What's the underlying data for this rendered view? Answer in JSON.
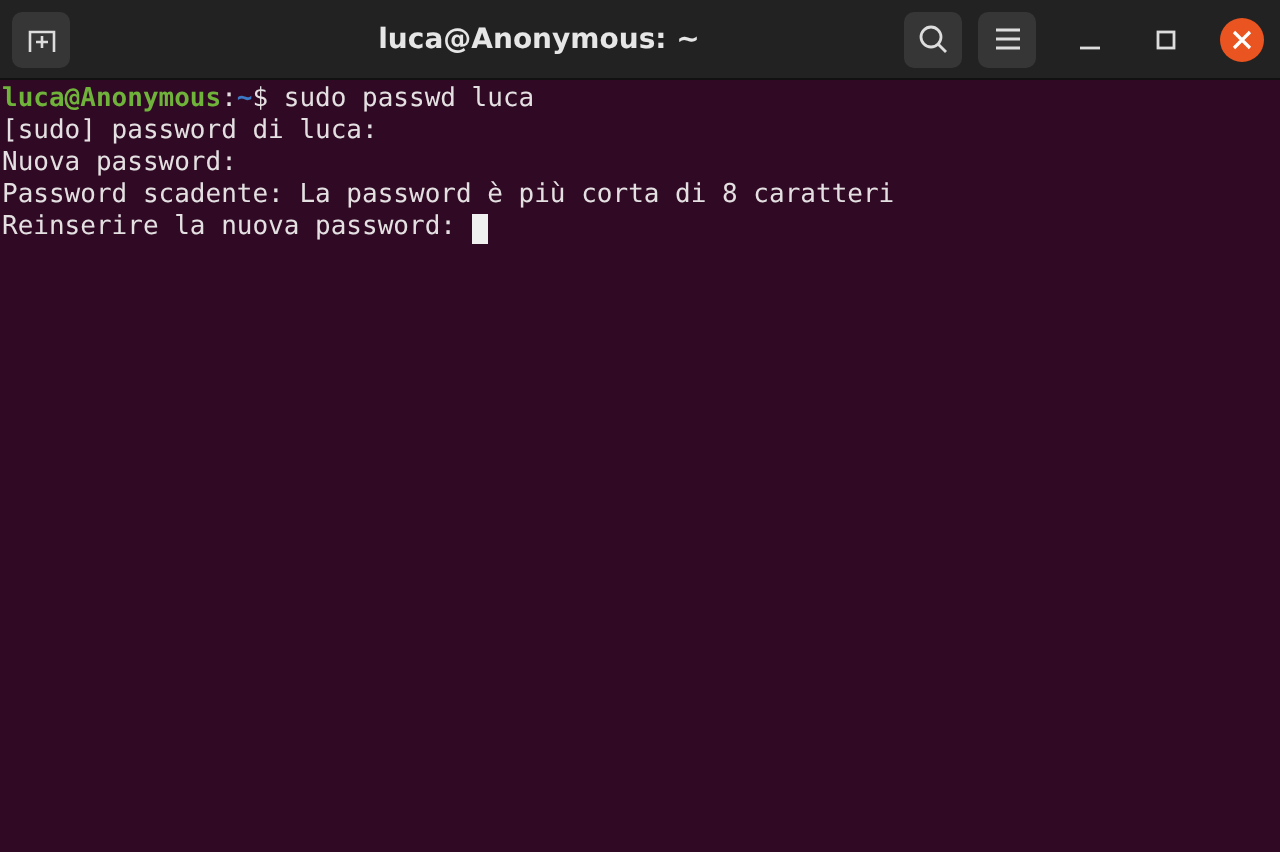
{
  "window": {
    "title": "luca@Anonymous: ~"
  },
  "terminal": {
    "lines": [
      {
        "segments": [
          {
            "kind": "user",
            "text": "luca@Anonymous"
          },
          {
            "kind": "plain",
            "text": ":"
          },
          {
            "kind": "path",
            "text": "~"
          },
          {
            "kind": "plain",
            "text": "$ sudo passwd luca"
          }
        ],
        "cursor": false
      },
      {
        "segments": [
          {
            "kind": "plain",
            "text": "[sudo] password di luca:"
          }
        ],
        "cursor": false
      },
      {
        "segments": [
          {
            "kind": "plain",
            "text": "Nuova password:"
          }
        ],
        "cursor": false
      },
      {
        "segments": [
          {
            "kind": "plain",
            "text": "Password scadente: La password è più corta di 8 caratteri"
          }
        ],
        "cursor": false
      },
      {
        "segments": [
          {
            "kind": "plain",
            "text": "Reinserire la nuova password: "
          }
        ],
        "cursor": true
      }
    ]
  }
}
